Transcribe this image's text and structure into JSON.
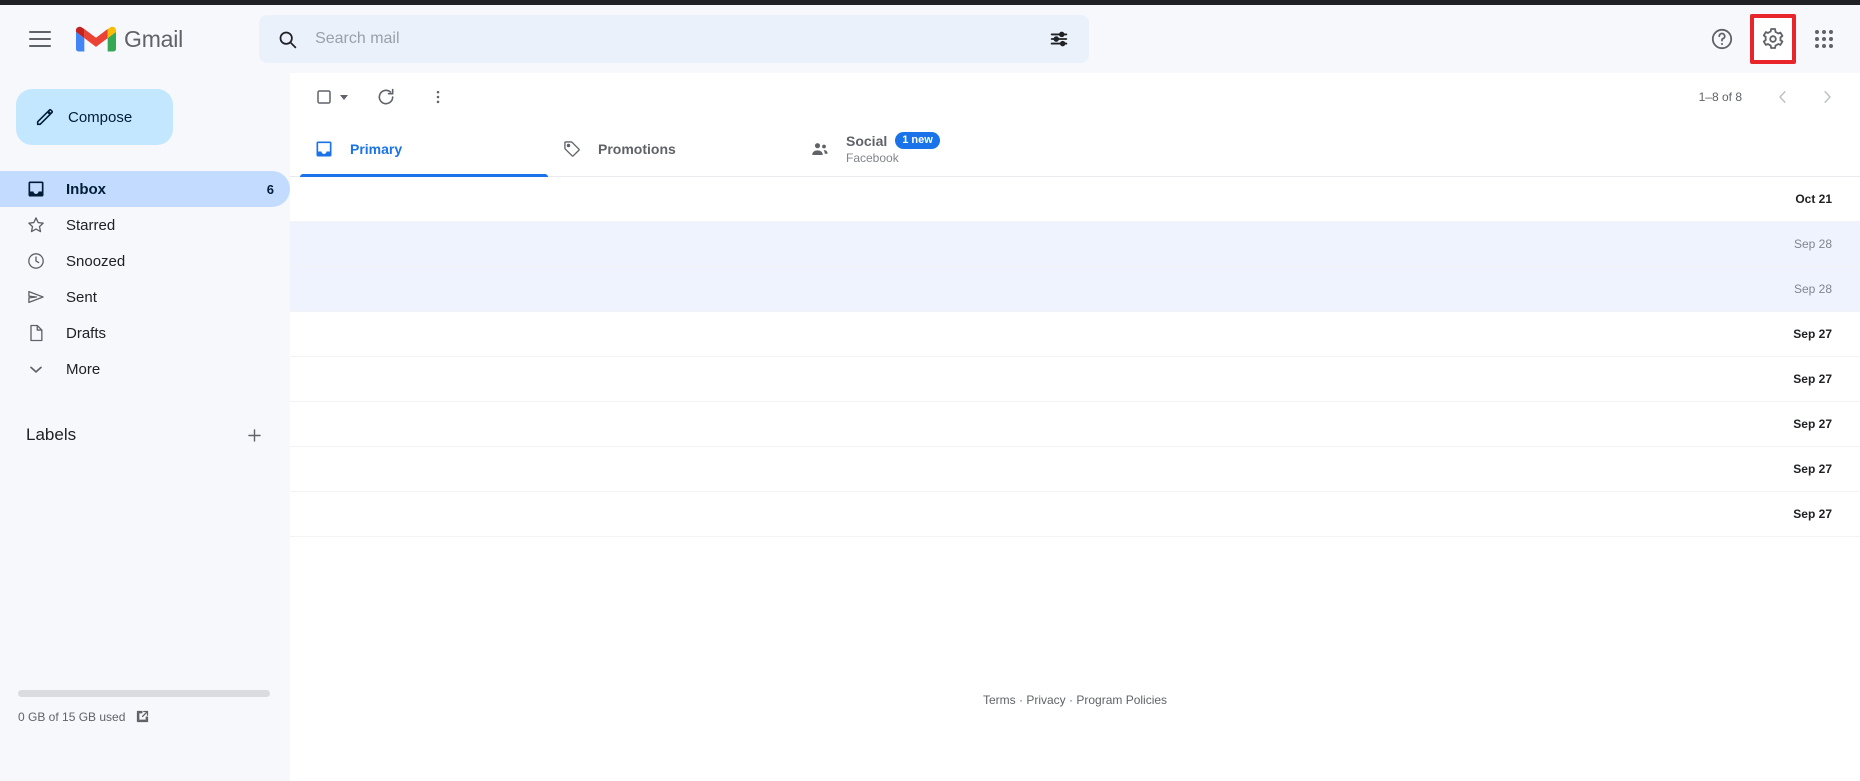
{
  "header": {
    "menu_icon": "hamburger-icon",
    "brand": "Gmail",
    "search": {
      "placeholder": "Search mail",
      "value": "",
      "search_icon": "search-icon",
      "filter_icon": "tune-filter-icon"
    },
    "help_icon": "help-circle-icon",
    "settings_icon": "gear-icon",
    "apps_icon": "apps-grid-icon",
    "highlight_color": "#e8252a"
  },
  "sidebar": {
    "compose": {
      "label": "Compose",
      "icon": "pencil-icon"
    },
    "items": [
      {
        "label": "Inbox",
        "icon": "inbox-icon",
        "count": "6",
        "active": true
      },
      {
        "label": "Starred",
        "icon": "star-icon",
        "count": "",
        "active": false
      },
      {
        "label": "Snoozed",
        "icon": "clock-icon",
        "count": "",
        "active": false
      },
      {
        "label": "Sent",
        "icon": "send-icon",
        "count": "",
        "active": false
      },
      {
        "label": "Drafts",
        "icon": "document-icon",
        "count": "",
        "active": false
      },
      {
        "label": "More",
        "icon": "chevron-down-icon",
        "count": "",
        "active": false
      }
    ],
    "labels_header": "Labels",
    "add_label_icon": "plus-icon"
  },
  "toolbar": {
    "select_checkbox_icon": "checkbox-icon",
    "select_dropdown_icon": "chevron-down-icon",
    "refresh_icon": "refresh-icon",
    "more_icon": "more-vertical-icon",
    "pagination": "1–8 of 8",
    "prev_icon": "chevron-left-icon",
    "next_icon": "chevron-right-icon"
  },
  "tabs": [
    {
      "label": "Primary",
      "icon": "inbox-tab-icon",
      "sub": "",
      "badge": "",
      "active": true
    },
    {
      "label": "Promotions",
      "icon": "tag-icon",
      "sub": "",
      "badge": "",
      "active": false
    },
    {
      "label": "Social",
      "icon": "people-icon",
      "sub": "Facebook",
      "badge": "1 new",
      "active": false
    }
  ],
  "mail_rows": [
    {
      "date": "Oct 21",
      "selected": false
    },
    {
      "date": "Sep 28",
      "selected": true
    },
    {
      "date": "Sep 28",
      "selected": true
    },
    {
      "date": "Sep 27",
      "selected": false
    },
    {
      "date": "Sep 27",
      "selected": false
    },
    {
      "date": "Sep 27",
      "selected": false
    },
    {
      "date": "Sep 27",
      "selected": false
    },
    {
      "date": "Sep 27",
      "selected": false
    }
  ],
  "footer": {
    "terms": "Terms",
    "sep1": "·",
    "privacy": "Privacy",
    "sep2": "·",
    "policies": "Program Policies"
  },
  "storage": {
    "text": "0 GB of 15 GB used",
    "open_icon": "external-link-icon",
    "used_percent": 0
  }
}
